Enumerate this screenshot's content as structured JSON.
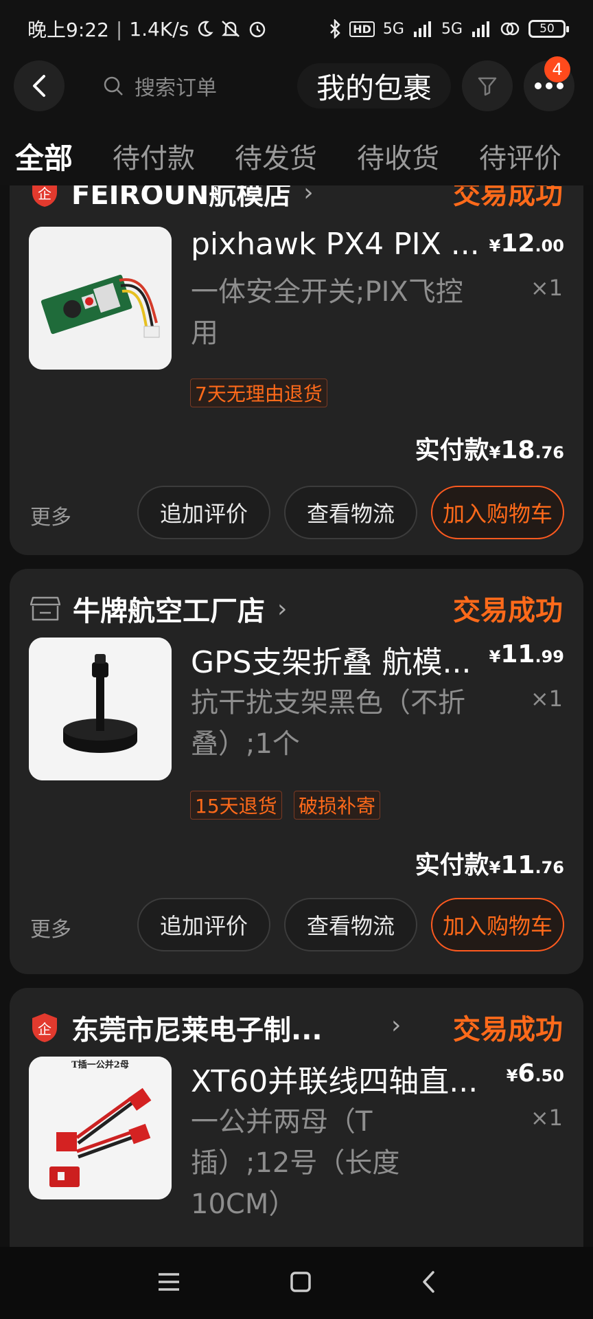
{
  "status_bar": {
    "time": "晚上9:22",
    "speed": "1.4K/s",
    "network1": "5G",
    "network2": "5G",
    "hd": "HD",
    "battery": "50"
  },
  "header": {
    "search_placeholder": "搜索订单",
    "package_button": "我的包裹",
    "badge_count": "4"
  },
  "tabs": [
    {
      "label": "全部",
      "active": true
    },
    {
      "label": "待付款"
    },
    {
      "label": "待发货"
    },
    {
      "label": "待收货"
    },
    {
      "label": "待评价"
    }
  ],
  "orders": [
    {
      "shop": "FEIROUN航模店",
      "status": "交易成功",
      "title": "pixhawk PX4 PIX ...",
      "desc": "一体安全开关;PIX飞控用",
      "price_int": "12",
      "price_dec": ".00",
      "qty": "×1",
      "tags": [
        "7天无理由退货"
      ],
      "paid_label": "实付款",
      "paid_int": "18",
      "paid_dec": ".76",
      "more": "更多",
      "actions": [
        "追加评价",
        "查看物流",
        "加入购物车"
      ]
    },
    {
      "shop": "牛牌航空工厂店",
      "status": "交易成功",
      "title": "GPS支架折叠 航模...",
      "desc": "抗干扰支架黑色（不折叠）;1个",
      "price_int": "11",
      "price_dec": ".99",
      "qty": "×1",
      "tags": [
        "15天退货",
        "破损补寄"
      ],
      "paid_label": "实付款",
      "paid_int": "11",
      "paid_dec": ".76",
      "more": "更多",
      "actions": [
        "追加评价",
        "查看物流",
        "加入购物车"
      ]
    },
    {
      "shop": "东莞市尼莱电子制...",
      "status": "交易成功",
      "title": "XT60并联线四轴直...",
      "desc": "一公并两母（T插）;12号（长度10CM）",
      "price_int": "6",
      "price_dec": ".50",
      "qty": "×1",
      "thumb_caption": "T插一公并2母"
    }
  ],
  "currency": "¥",
  "colors": {
    "accent": "#ff6a1a",
    "card_bg": "#232323",
    "page_bg": "#111111"
  }
}
